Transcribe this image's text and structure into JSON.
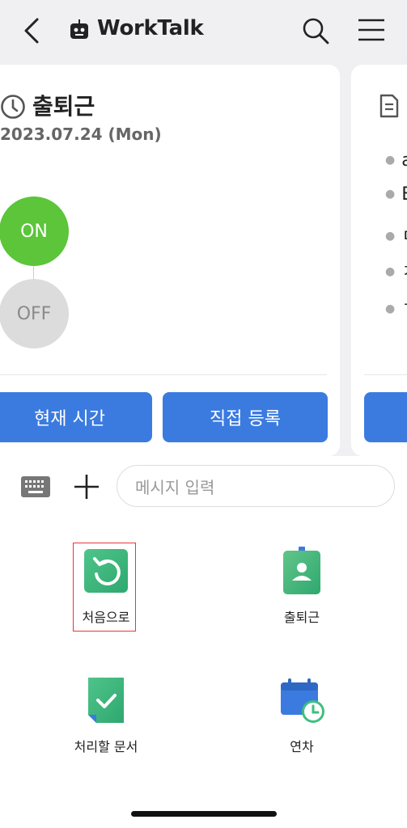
{
  "header": {
    "title": "WorkTalk",
    "back_icon": "chevron-left-icon",
    "search_icon": "search-icon",
    "menu_icon": "hamburger-menu-icon"
  },
  "attendance_card": {
    "title": "출퇴근",
    "date": "2023.07.24 (Mon)",
    "on_label": "ON",
    "off_label": "OFF",
    "current_time_button": "현재 시간",
    "manual_register_button": "직접 등록"
  },
  "second_card": {
    "bullets": [
      "a",
      "E",
      "ㄷ",
      "ㅈ",
      "ㄱ"
    ]
  },
  "composer": {
    "placeholder": "메시지 입력"
  },
  "actions": [
    {
      "label": "처음으로",
      "icon": "restart-icon"
    },
    {
      "label": "출퇴근",
      "icon": "badge-icon"
    },
    {
      "label": "처리할 문서",
      "icon": "document-check-icon"
    },
    {
      "label": "연차",
      "icon": "calendar-clock-icon"
    }
  ],
  "colors": {
    "primary_blue": "#3b7be0",
    "on_green": "#5cc53a",
    "off_gray": "#dcdcdc",
    "highlight_red": "#e33333"
  }
}
